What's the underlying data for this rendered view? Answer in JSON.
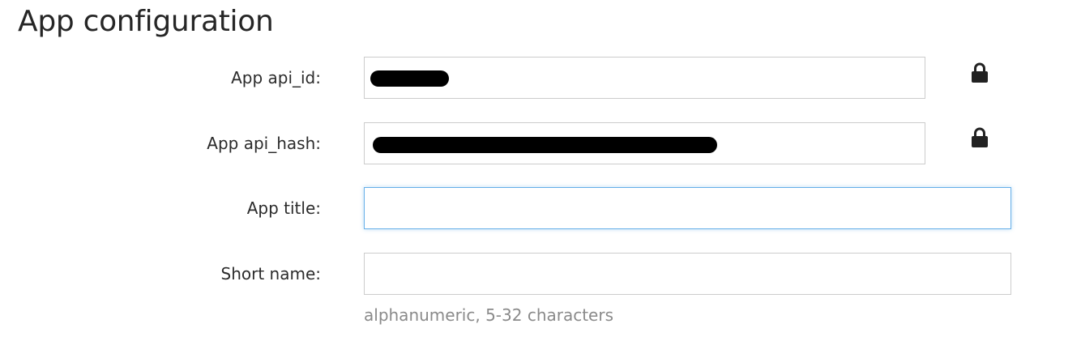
{
  "page": {
    "title": "App configuration"
  },
  "form": {
    "api_id": {
      "label": "App api_id:",
      "value": "",
      "redacted": true,
      "locked": true,
      "lock_icon": "lock-icon"
    },
    "api_hash": {
      "label": "App api_hash:",
      "value": "",
      "redacted": true,
      "locked": true,
      "lock_icon": "lock-icon"
    },
    "app_title": {
      "label": "App title:",
      "value": "",
      "focused": true
    },
    "short_name": {
      "label": "Short name:",
      "value": "",
      "hint": "alphanumeric, 5-32 characters"
    }
  },
  "colors": {
    "focus_border": "#66afe9",
    "input_border": "#cccccc",
    "hint_text": "#8a8a8a",
    "redaction": "#000000"
  }
}
